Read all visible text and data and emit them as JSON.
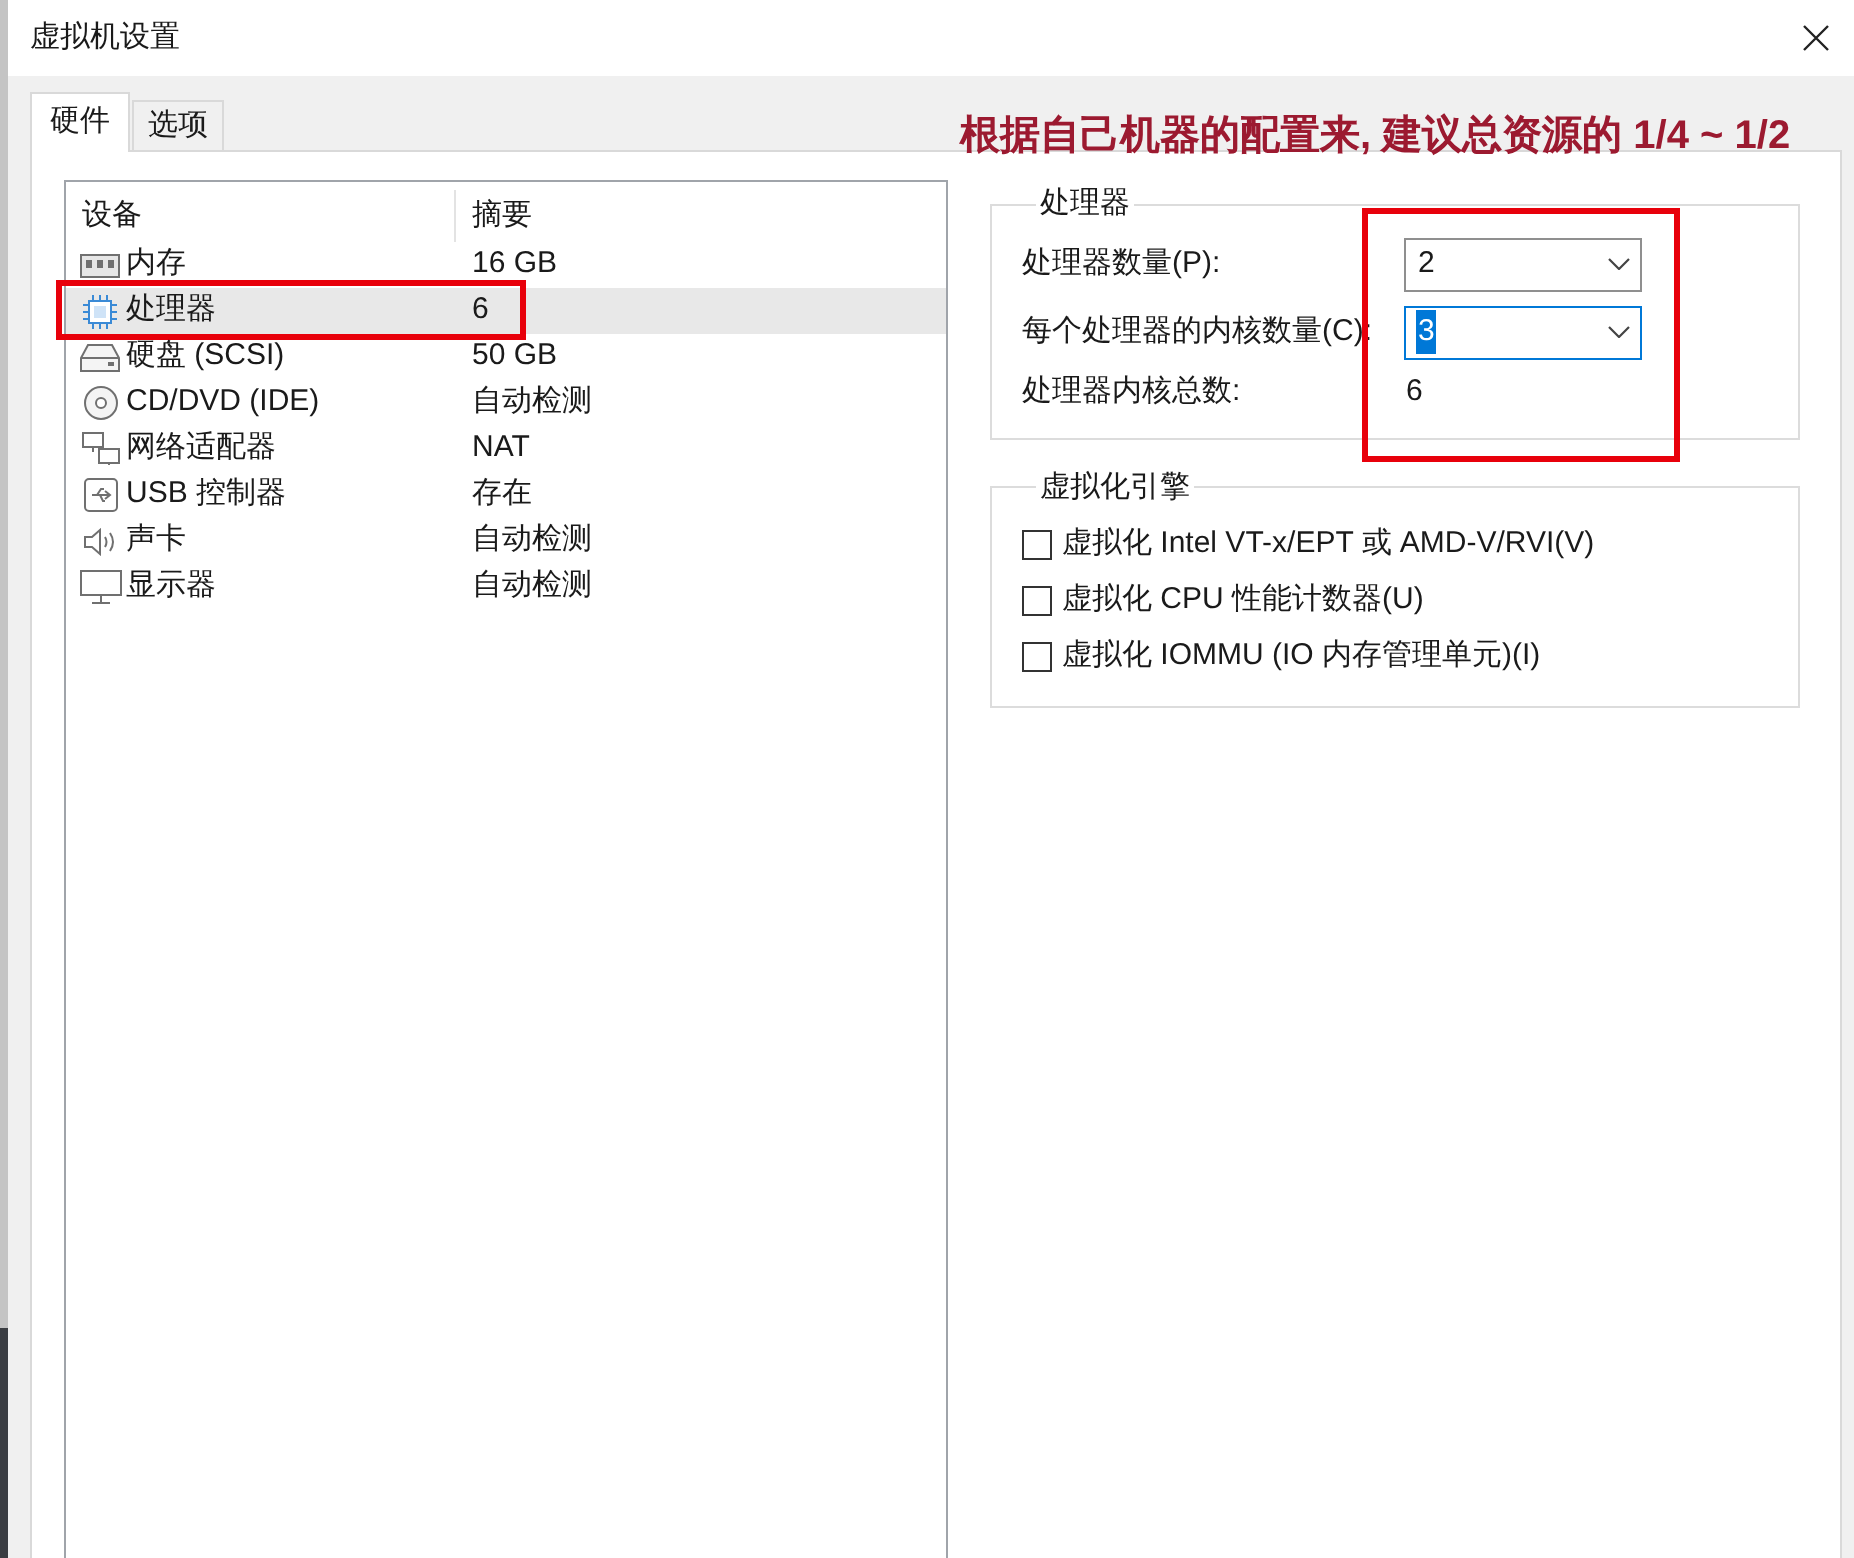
{
  "window": {
    "title": "虚拟机设置"
  },
  "tabs": [
    {
      "label": "硬件",
      "selected": true
    },
    {
      "label": "选项",
      "selected": false
    }
  ],
  "annotation": "根据自己机器的配置来, 建议总资源的 1/4 ~ 1/2",
  "device_list": {
    "columns": [
      "设备",
      "摘要"
    ],
    "rows": [
      {
        "kind": "memory",
        "device": "内存",
        "summary": "16 GB",
        "selected": false,
        "highlighted": false
      },
      {
        "kind": "cpu",
        "device": "处理器",
        "summary": "6",
        "selected": true,
        "highlighted": true
      },
      {
        "kind": "disk",
        "device": "硬盘 (SCSI)",
        "summary": "50 GB",
        "selected": false,
        "highlighted": false
      },
      {
        "kind": "cd",
        "device": "CD/DVD (IDE)",
        "summary": "自动检测",
        "selected": false,
        "highlighted": false
      },
      {
        "kind": "network",
        "device": "网络适配器",
        "summary": "NAT",
        "selected": false,
        "highlighted": false
      },
      {
        "kind": "usb",
        "device": "USB 控制器",
        "summary": "存在",
        "selected": false,
        "highlighted": false
      },
      {
        "kind": "sound",
        "device": "声卡",
        "summary": "自动检测",
        "selected": false,
        "highlighted": false
      },
      {
        "kind": "display",
        "device": "显示器",
        "summary": "自动检测",
        "selected": false,
        "highlighted": false
      }
    ]
  },
  "processor_group": {
    "title": "处理器",
    "highlighted": true,
    "fields": [
      {
        "kind": "dropdown",
        "label": "处理器数量(P):",
        "value": "2",
        "focused": false
      },
      {
        "kind": "dropdown",
        "label": "每个处理器的内核数量(C):",
        "value": "3",
        "focused": true
      },
      {
        "kind": "readout",
        "label": "处理器内核总数:",
        "value": "6"
      }
    ]
  },
  "virtualization_group": {
    "title": "虚拟化引擎",
    "options": [
      {
        "label": "虚拟化 Intel VT-x/EPT 或 AMD-V/RVI(V)",
        "checked": false
      },
      {
        "label": "虚拟化 CPU 性能计数器(U)",
        "checked": false
      },
      {
        "label": "虚拟化 IOMMU (IO 内存管理单元)(I)",
        "checked": false
      }
    ]
  }
}
